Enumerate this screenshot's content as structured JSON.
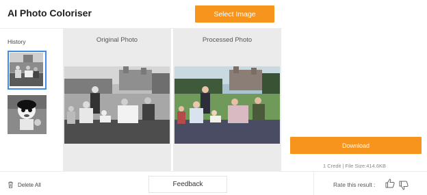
{
  "app": {
    "title": "AI Photo Coloriser",
    "select_image_label": "Select Image"
  },
  "sidebar": {
    "history_label": "History",
    "items": [
      {
        "name": "history-thumbnail-family-photo",
        "selected": true
      },
      {
        "name": "history-thumbnail-cartoon",
        "selected": false
      }
    ],
    "delete_all_label": "Delete All"
  },
  "panels": {
    "original_title": "Original Photo",
    "processed_title": "Processed Photo"
  },
  "result": {
    "download_label": "Download",
    "meta": "1 Credit | File Size:414.6KB"
  },
  "footer": {
    "feedback_label": "Feedback",
    "rate_label": "Rate this result :"
  },
  "colors": {
    "accent": "#f7941d",
    "selected_border": "#3a8ee6",
    "panel_bg": "#ebebeb"
  },
  "icons": [
    "close-icon",
    "trash-icon",
    "thumbs-up-icon",
    "thumbs-down-icon"
  ]
}
